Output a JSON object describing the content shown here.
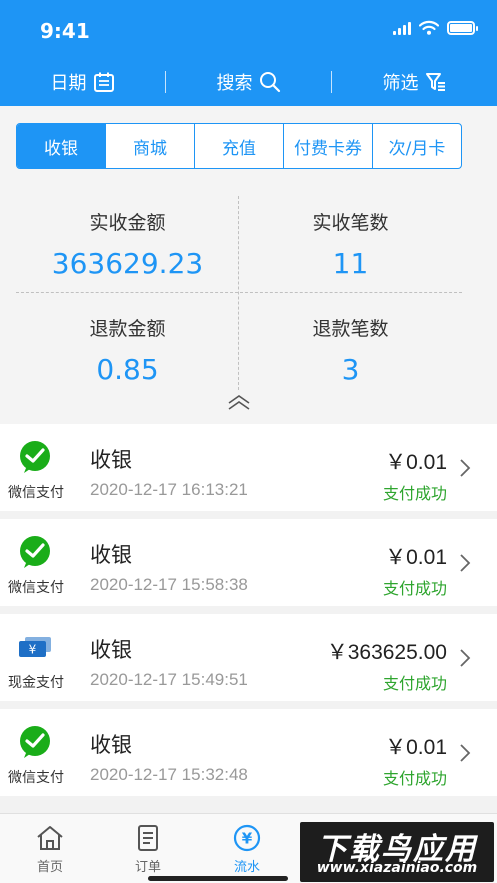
{
  "status_bar": {
    "time": "9:41"
  },
  "toolbar": {
    "date_label": "日期",
    "search_label": "搜索",
    "filter_label": "筛选"
  },
  "tabs": [
    {
      "label": "收银",
      "active": true
    },
    {
      "label": "商城",
      "active": false
    },
    {
      "label": "充值",
      "active": false
    },
    {
      "label": "付费卡券",
      "active": false
    },
    {
      "label": "次/月卡",
      "active": false
    }
  ],
  "stats": {
    "received_amount_label": "实收金额",
    "received_amount": "363629.23",
    "received_count_label": "实收笔数",
    "received_count": "11",
    "refund_amount_label": "退款金额",
    "refund_amount": "0.85",
    "refund_count_label": "退款笔数",
    "refund_count": "3"
  },
  "transactions": [
    {
      "icon": "wechat-pay-icon",
      "method": "微信支付",
      "title": "收银",
      "time": "2020-12-17 16:13:21",
      "amount": "￥0.01",
      "status": "支付成功"
    },
    {
      "icon": "wechat-pay-icon",
      "method": "微信支付",
      "title": "收银",
      "time": "2020-12-17 15:58:38",
      "amount": "￥0.01",
      "status": "支付成功"
    },
    {
      "icon": "cash-icon",
      "method": "现金支付",
      "title": "收银",
      "time": "2020-12-17 15:49:51",
      "amount": "￥363625.00",
      "status": "支付成功"
    },
    {
      "icon": "wechat-pay-icon",
      "method": "微信支付",
      "title": "收银",
      "time": "2020-12-17 15:32:48",
      "amount": "￥0.01",
      "status": "支付成功"
    }
  ],
  "bottom_nav": [
    {
      "label": "首页",
      "icon": "home-icon",
      "active": false
    },
    {
      "label": "订单",
      "icon": "order-icon",
      "active": false
    },
    {
      "label": "流水",
      "icon": "yuan-icon",
      "active": true
    }
  ],
  "watermark": {
    "title": "下载鸟应用",
    "url": "www.xiazainiao.com"
  },
  "colors": {
    "primary": "#1e95f5",
    "success": "#2fa52f",
    "wechat": "#1aad19",
    "cash": "#1e6fc6"
  }
}
